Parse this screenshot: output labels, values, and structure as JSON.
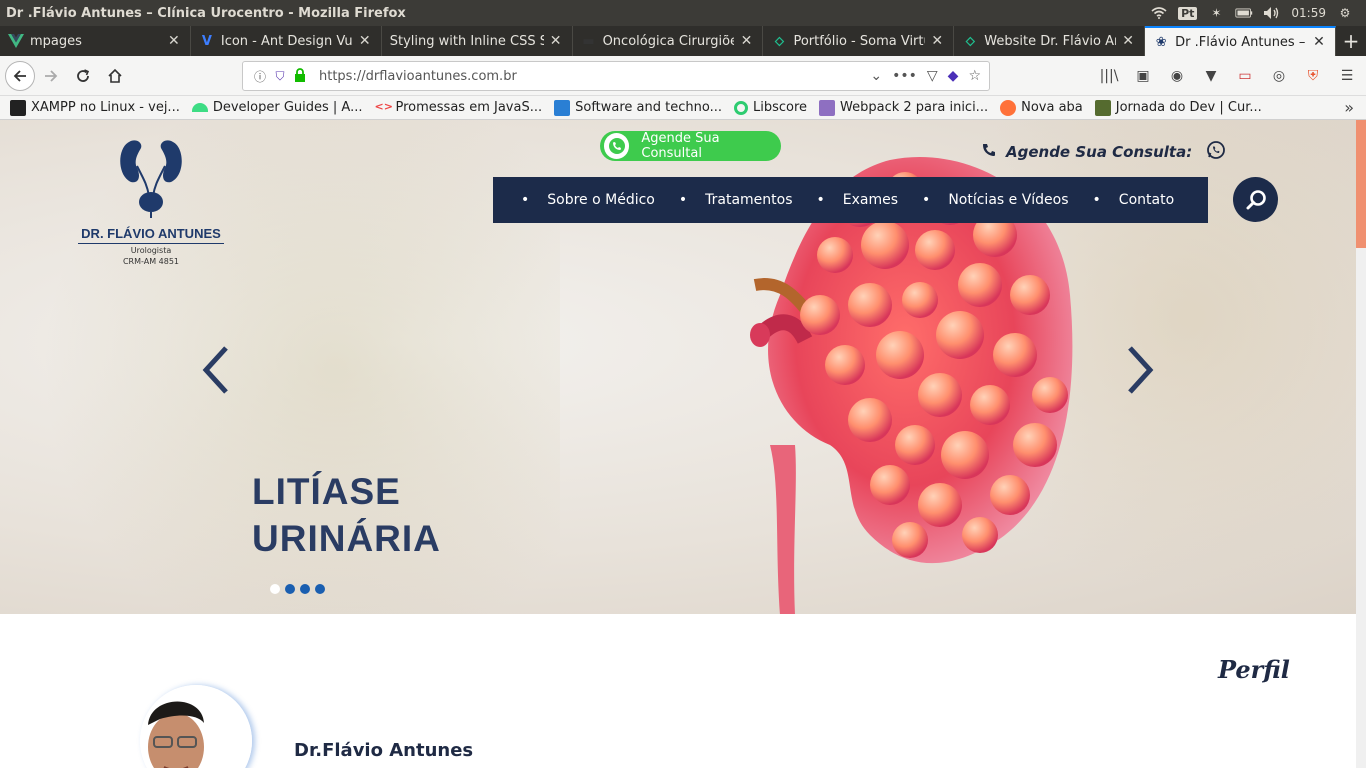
{
  "os": {
    "window_title": "Dr .Flávio Antunes – Clínica Urocentro - Mozilla Firefox",
    "keyboard_layout": "Pt",
    "clock": "01:59"
  },
  "tabs": [
    {
      "label": "mpages",
      "icon": "vue-icon",
      "color": "#41b883"
    },
    {
      "label": "Icon - Ant Design Vue",
      "icon": "antdv-icon",
      "color": "#3d7eff"
    },
    {
      "label": "Styling with Inline CSS Styl",
      "icon": "",
      "color": ""
    },
    {
      "label": "Oncológica Cirurgiões",
      "icon": "site-icon",
      "color": "#333"
    },
    {
      "label": "Portfólio - Soma Virtu",
      "icon": "soma-icon",
      "color": "#1fbf8f"
    },
    {
      "label": "Website Dr. Flávio Ant",
      "icon": "soma-icon",
      "color": "#1fbf8f"
    },
    {
      "label": "Dr .Flávio Antunes – Cl",
      "icon": "kidney-icon",
      "color": "#1f3a6b"
    }
  ],
  "navbar": {
    "url": "https://drflavioantunes.com.br",
    "url_scheme": "https://",
    "url_host": "drflavioantunes.com.br"
  },
  "bookmarks": [
    {
      "label": "XAMPP no Linux - vej...",
      "color": "#222"
    },
    {
      "label": "Developer Guides | A...",
      "color": "#3ddc84"
    },
    {
      "label": "Promessas em JavaS...",
      "color": "#e44"
    },
    {
      "label": "Software and techno...",
      "color": "#2a7fd4"
    },
    {
      "label": "Libscore",
      "color": "#2ecc71"
    },
    {
      "label": "Webpack 2 para inici...",
      "color": "#8e6fc1"
    },
    {
      "label": "Nova aba",
      "color": "#ff7139"
    },
    {
      "label": "Jornada do Dev | Cur...",
      "color": "#556b2f"
    }
  ],
  "site": {
    "logo": {
      "name": "DR. FLÁVIO ANTUNES",
      "role": "Urologista",
      "crm": "CRM-AM 4851"
    },
    "whatsapp_button": "Agende Sua Consultal",
    "agende_label": "Agende Sua Consulta:",
    "nav": [
      "Sobre o Médico",
      "Tratamentos",
      "Exames",
      "Notícias e Vídeos",
      "Contato"
    ],
    "hero": {
      "title_line1": "LITÍASE",
      "title_line2": "URINÁRIA",
      "slide_count": 4,
      "active_slide": 1
    },
    "perfil": "Perfil",
    "doctor_name": "Dr.Flávio Antunes"
  },
  "colors": {
    "brand_navy": "#1c2b4a",
    "whatsapp_green": "#3ecb4d",
    "hero_title": "#2a3c63",
    "slider_dot": "#1a5eb0"
  }
}
